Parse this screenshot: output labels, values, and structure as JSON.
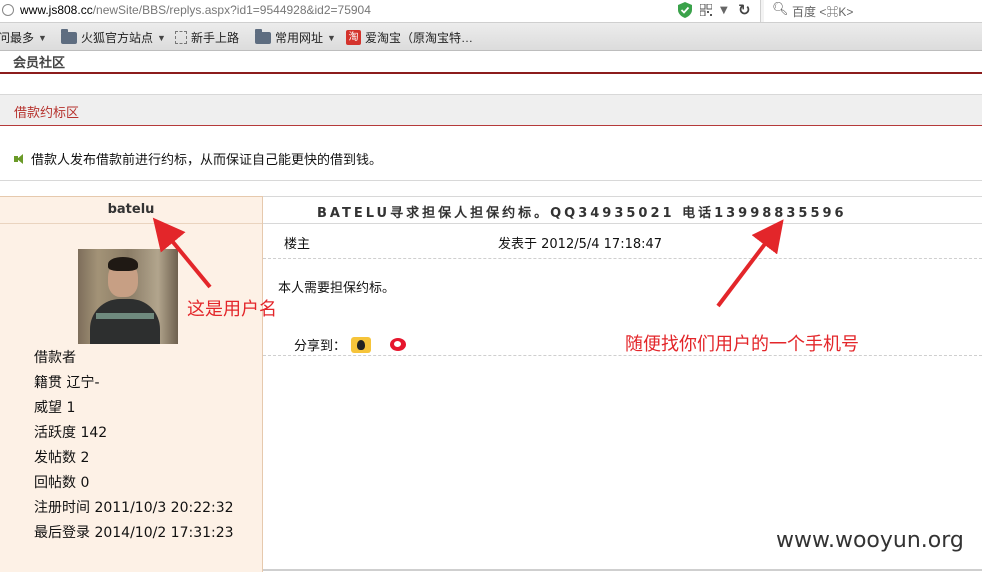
{
  "browser": {
    "url_host": "www.js808.cc",
    "url_path": "/newSite/BBS/replys.aspx?id1=9544928&id2=75904",
    "search_placeholder": "百度 <⌘K>",
    "bookmarks": [
      {
        "label": "问最多",
        "icon": "caret"
      },
      {
        "label": "火狐官方站点",
        "icon": "folder-icon"
      },
      {
        "label": "新手上路",
        "icon": "page-icon"
      },
      {
        "label": "常用网址",
        "icon": "folder-icon"
      },
      {
        "label": "爱淘宝（原淘宝特…",
        "icon": "taobao-icon"
      }
    ]
  },
  "page": {
    "community_title": "会员社区",
    "section_title": "借款约标区",
    "section_desc": "借款人发布借款前进行约标，从而保证自己能更快的借到钱。",
    "topic_title": "BATELU寻求担保人担保约标。QQ34935021  电话13998835596",
    "floor_label": "楼主",
    "posted_at": "发表于 2012/5/4 17:18:47",
    "content": "本人需要担保约标。",
    "share_label": "分享到："
  },
  "user": {
    "username": "batelu",
    "role": "借款者",
    "origin": "籍贯 辽宁-",
    "prestige": "威望 1",
    "activity": "活跃度 142",
    "posts": "发帖数 2",
    "replies": "回帖数 0",
    "registered": "注册时间 2011/10/3 20:22:32",
    "last_login": "最后登录 2014/10/2 17:31:23"
  },
  "annotations": {
    "username_note": "这是用户名",
    "phone_note": "随便找你们用户的一个手机号",
    "watermark": "www.wooyun.org"
  },
  "colors": {
    "accent_red": "#b6322d",
    "annotation_red": "#e3262a",
    "sidebar_bg": "#fdf1e6"
  }
}
